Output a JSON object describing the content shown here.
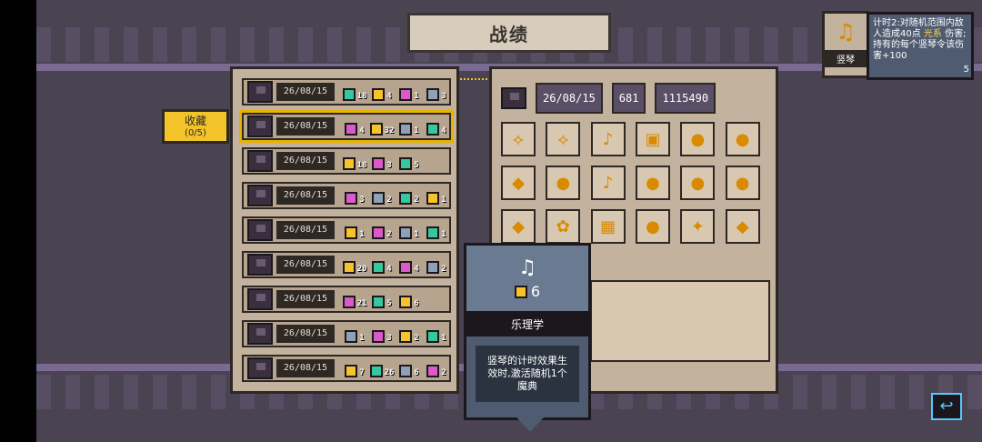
{
  "screen_title": "战绩",
  "collect": {
    "label": "收藏",
    "count": "(0/5)"
  },
  "runs": [
    {
      "date": "26/08/15",
      "chips": [
        {
          "color": "green",
          "n": "18"
        },
        {
          "color": "yellow",
          "n": "4"
        },
        {
          "color": "pink",
          "n": "1"
        },
        {
          "color": "grey",
          "n": "3"
        }
      ]
    },
    {
      "date": "26/08/15",
      "chips": [
        {
          "color": "pink",
          "n": "4"
        },
        {
          "color": "yellow",
          "n": "32"
        },
        {
          "color": "grey",
          "n": "1"
        },
        {
          "color": "green",
          "n": "4"
        }
      ],
      "selected": true
    },
    {
      "date": "26/08/15",
      "chips": [
        {
          "color": "yellow",
          "n": "18"
        },
        {
          "color": "pink",
          "n": "3"
        },
        {
          "color": "green",
          "n": "5"
        }
      ]
    },
    {
      "date": "26/08/15",
      "chips": [
        {
          "color": "pink",
          "n": "3"
        },
        {
          "color": "grey",
          "n": "2"
        },
        {
          "color": "green",
          "n": "2"
        },
        {
          "color": "yellow",
          "n": "1"
        }
      ]
    },
    {
      "date": "26/08/15",
      "chips": [
        {
          "color": "yellow",
          "n": "1"
        },
        {
          "color": "pink",
          "n": "2"
        },
        {
          "color": "grey",
          "n": "1"
        },
        {
          "color": "green",
          "n": "1"
        }
      ]
    },
    {
      "date": "26/08/15",
      "chips": [
        {
          "color": "yellow",
          "n": "20"
        },
        {
          "color": "green",
          "n": "4"
        },
        {
          "color": "pink",
          "n": "4"
        },
        {
          "color": "grey",
          "n": "2"
        }
      ]
    },
    {
      "date": "26/08/15",
      "chips": [
        {
          "color": "pink",
          "n": "21"
        },
        {
          "color": "green",
          "n": "5"
        },
        {
          "color": "yellow",
          "n": "6"
        }
      ]
    },
    {
      "date": "26/08/15",
      "chips": [
        {
          "color": "grey",
          "n": "1"
        },
        {
          "color": "pink",
          "n": "3"
        },
        {
          "color": "yellow",
          "n": "2"
        },
        {
          "color": "green",
          "n": "1"
        }
      ]
    },
    {
      "date": "26/08/15",
      "chips": [
        {
          "color": "yellow",
          "n": "7"
        },
        {
          "color": "green",
          "n": "26"
        },
        {
          "color": "grey",
          "n": "6"
        },
        {
          "color": "pink",
          "n": "2"
        }
      ]
    }
  ],
  "detail": {
    "date": "26/08/15",
    "stat1": "681",
    "stat2": "1115490"
  },
  "tooltip": {
    "count": "6",
    "title": "乐理学",
    "description": "竖琴的计时效果生效时,激活随机1个魔典"
  },
  "badge": {
    "label": "竖琴",
    "level": "5"
  },
  "badge_tip": {
    "line1": "计时2:对随机范围内敌人造成40点",
    "highlight": "光系",
    "line2": "伤害;持有的每个竖琴令该伤害+100"
  }
}
